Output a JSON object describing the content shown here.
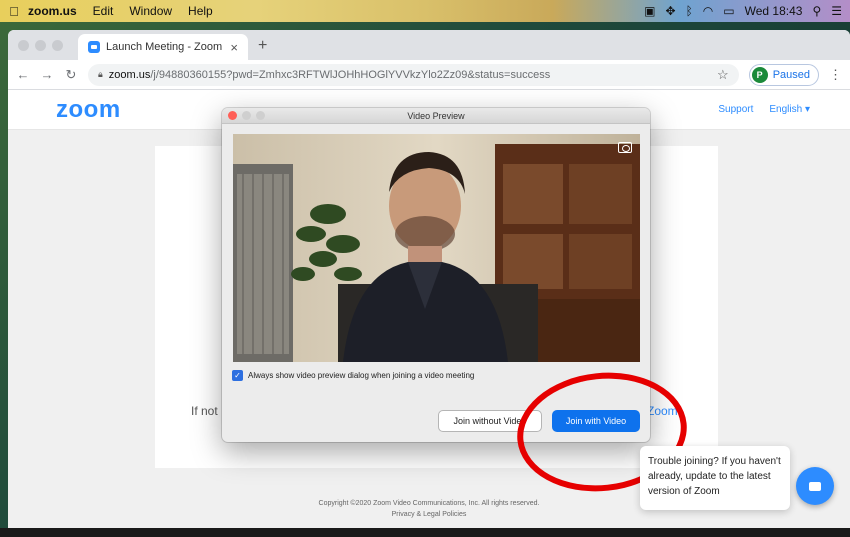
{
  "menubar": {
    "app": "zoom.us",
    "items": [
      "Edit",
      "Window",
      "Help"
    ],
    "clock": "Wed 18:43"
  },
  "browser": {
    "tab_title": "Launch Meeting - Zoom",
    "url_host": "zoom.us",
    "url_path": "/j/94880360155?pwd=Zmhxc3RFTWlJOHhHOGlYVVkzYlo2Zz09&status=success",
    "profile_initial": "P",
    "profile_status": "Paused"
  },
  "page": {
    "logo": "zoom",
    "support_link": "Support",
    "language": "English ▾",
    "card_text_prefix": "If not",
    "card_link_suffix": "Zoom.",
    "footer_copyright": "Copyright ©2020 Zoom Video Communications, Inc. All rights reserved.",
    "footer_links": "Privacy & Legal Policies"
  },
  "dialog": {
    "title": "Video Preview",
    "checkbox_label": "Always show video preview dialog when joining a video meeting",
    "join_without_video": "Join without Video",
    "join_with_video": "Join with Video"
  },
  "chat": {
    "message": "Trouble joining? If you haven't already, update to the latest version of Zoom"
  },
  "colors": {
    "zoom_blue": "#2d8cff",
    "button_blue": "#0e72ed",
    "annotation_red": "#e60000"
  }
}
